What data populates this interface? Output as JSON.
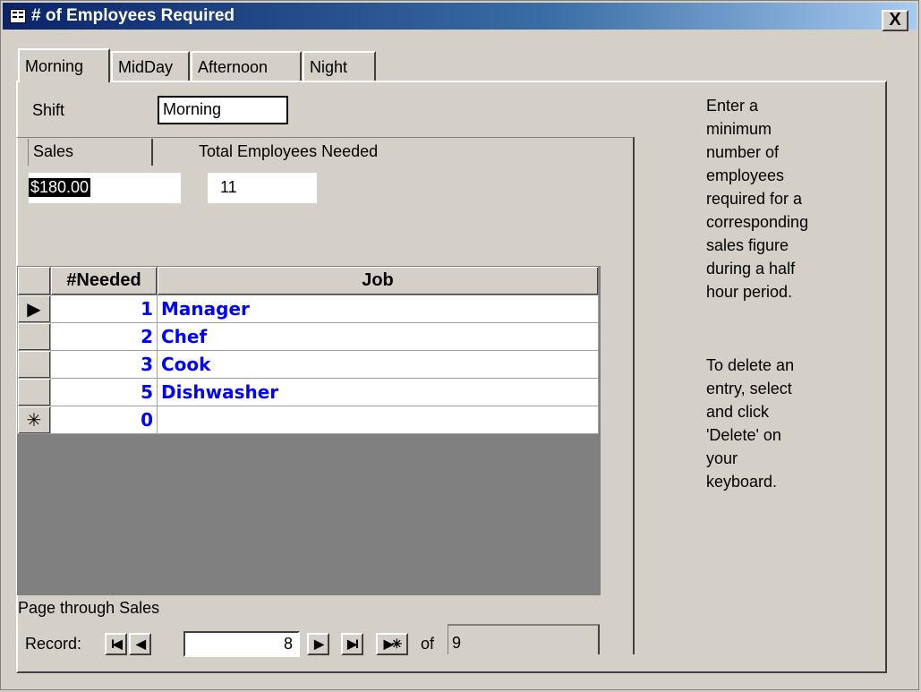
{
  "window": {
    "title": "# of Employees Required",
    "close_label": "X"
  },
  "tabs": [
    {
      "label": "Morning",
      "active": true
    },
    {
      "label": "MidDay",
      "active": false
    },
    {
      "label": "Afternoon",
      "active": false
    },
    {
      "label": "Night",
      "active": false
    }
  ],
  "shift": {
    "label": "Shift",
    "value": "Morning"
  },
  "sales": {
    "label": "Sales",
    "value": "$180.00"
  },
  "total": {
    "label": "Total Employees Needed",
    "value": "11"
  },
  "grid": {
    "headers": [
      "#Needed",
      "Job"
    ],
    "rows": [
      {
        "selector": "▶",
        "needed": "1",
        "job": "Manager"
      },
      {
        "selector": "",
        "needed": "2",
        "job": "Chef"
      },
      {
        "selector": "",
        "needed": "3",
        "job": "Cook"
      },
      {
        "selector": "",
        "needed": "5",
        "job": "Dishwasher"
      },
      {
        "selector": "✳",
        "needed": "0",
        "job": ""
      }
    ]
  },
  "page_through": "Page through Sales",
  "navigator": {
    "label": "Record:",
    "first": "I◀",
    "prev": "◀",
    "current": "8",
    "next": "▶",
    "last": "▶I",
    "new": "▶✳",
    "of_label": "of",
    "total": "9"
  },
  "instructions": {
    "enter": "Enter a\nminimum\nnumber of\nemployees\nrequired for a\ncorresponding\n sales figure\nduring a half\nhour period.",
    "delete": "To delete an\nentry, select\nand click\n'Delete' on\nyour\nkeyboard."
  }
}
